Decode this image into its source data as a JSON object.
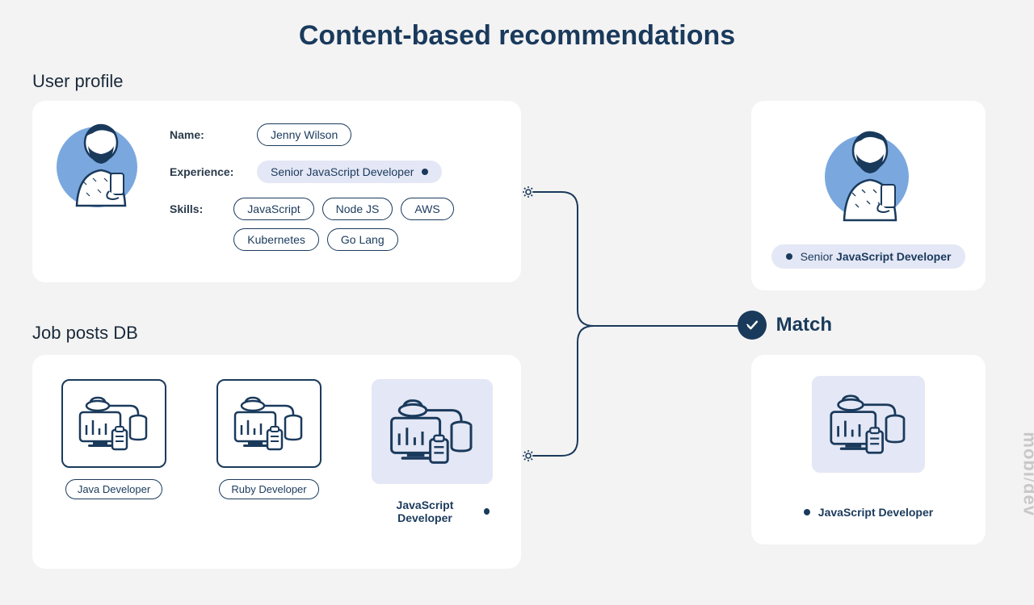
{
  "title": "Content-based recommendations",
  "sections": {
    "user_profile": "User profile",
    "job_posts": "Job posts DB"
  },
  "profile": {
    "labels": {
      "name": "Name:",
      "experience": "Experience:",
      "skills": "Skills:"
    },
    "name": "Jenny Wilson",
    "experience": "Senior JavaScript Developer",
    "skills": [
      "JavaScript",
      "Node JS",
      "AWS",
      "Kubernetes",
      "Go Lang"
    ]
  },
  "jobs": [
    {
      "label": "Java Developer",
      "highlighted": false
    },
    {
      "label": "Ruby Developer",
      "highlighted": false
    },
    {
      "label": "JavaScript Developer",
      "highlighted": true
    }
  ],
  "match": {
    "label": "Match",
    "profile_prefix": "Senior",
    "profile_bold": "JavaScript Developer",
    "job": "JavaScript Developer"
  },
  "watermark": "mobidev"
}
